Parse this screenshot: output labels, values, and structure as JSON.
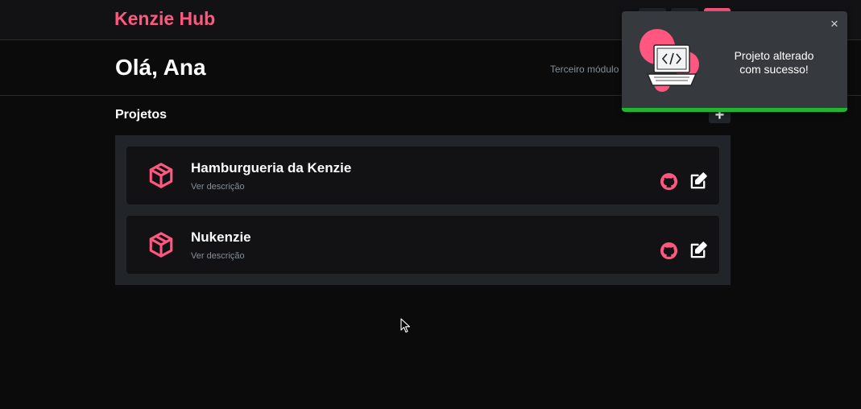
{
  "header": {
    "logo": "Kenzie Hub"
  },
  "profile": {
    "greeting": "Olá, Ana",
    "module": "Terceiro módulo"
  },
  "projects": {
    "title": "Projetos",
    "add_label": "+",
    "items": [
      {
        "name": "Hamburgueria da Kenzie",
        "description": "Ver descrição"
      },
      {
        "name": "Nukenzie",
        "description": "Ver descrição"
      }
    ]
  },
  "toast": {
    "line1": "Projeto alterado",
    "line2": "com sucesso!",
    "close": "×",
    "progress": 1.0
  },
  "colors": {
    "brand": "#ff577f",
    "background": "#0b0b0c",
    "card": "#121214",
    "panel": "#212529",
    "success": "#1fb52f"
  },
  "icons": [
    "cube-icon",
    "github-icon",
    "edit-icon",
    "close-icon",
    "laptop-code-icon"
  ]
}
